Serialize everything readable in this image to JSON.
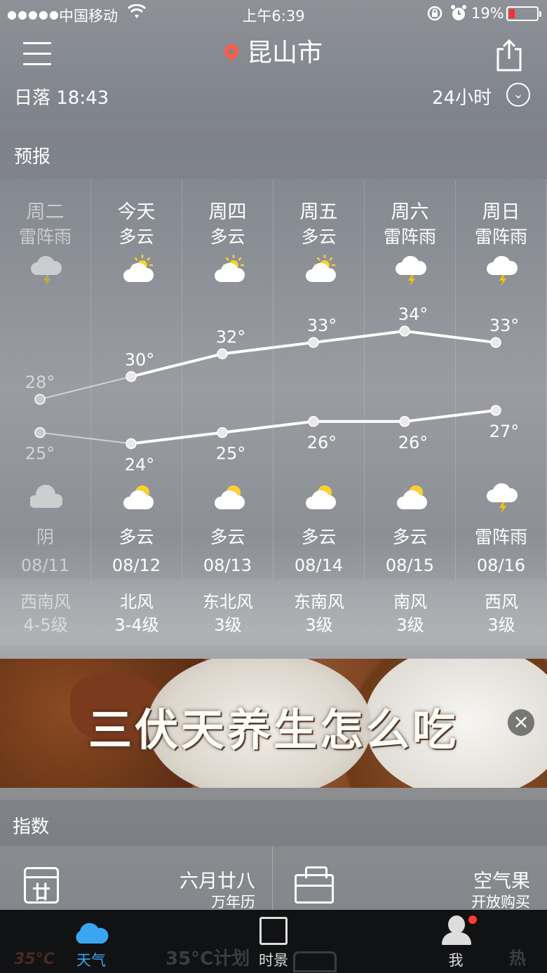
{
  "status_bar": {
    "signal": "●●●●●",
    "carrier": "中国移动",
    "time": "上午6:39",
    "battery_pct": "19%",
    "battery_level": 0.19
  },
  "header": {
    "city": "昆山市",
    "sunset": "日落 18:43",
    "hours_label": "24小时"
  },
  "forecast": {
    "title": "预报",
    "days": [
      {
        "day": "周二",
        "cond_day": "雷阵雨",
        "icon_day": "thunder-cloud-icon",
        "high": "28°",
        "low": "25°",
        "icon_night": "cloud-icon",
        "cond_night": "阴",
        "date": "08/11",
        "wind_dir": "西南风",
        "wind_lvl": "4-5级",
        "past": true
      },
      {
        "day": "今天",
        "cond_day": "多云",
        "icon_day": "partly-sunny-icon",
        "high": "30°",
        "low": "24°",
        "icon_night": "partly-moon-icon",
        "cond_night": "多云",
        "date": "08/12",
        "wind_dir": "北风",
        "wind_lvl": "3-4级",
        "past": false
      },
      {
        "day": "周四",
        "cond_day": "多云",
        "icon_day": "partly-sunny-icon",
        "high": "32°",
        "low": "25°",
        "icon_night": "partly-moon-icon",
        "cond_night": "多云",
        "date": "08/13",
        "wind_dir": "东北风",
        "wind_lvl": "3级",
        "past": false
      },
      {
        "day": "周五",
        "cond_day": "多云",
        "icon_day": "partly-sunny-icon",
        "high": "33°",
        "low": "26°",
        "icon_night": "partly-moon-icon",
        "cond_night": "多云",
        "date": "08/14",
        "wind_dir": "东南风",
        "wind_lvl": "3级",
        "past": false
      },
      {
        "day": "周六",
        "cond_day": "雷阵雨",
        "icon_day": "thunder-cloud-icon",
        "high": "34°",
        "low": "26°",
        "icon_night": "partly-moon-icon",
        "cond_night": "多云",
        "date": "08/15",
        "wind_dir": "南风",
        "wind_lvl": "3级",
        "past": false
      },
      {
        "day": "周日",
        "cond_day": "雷阵雨",
        "icon_day": "thunder-cloud-icon",
        "high": "33°",
        "low": "27°",
        "icon_night": "thunder-cloud-icon",
        "cond_night": "雷阵雨",
        "date": "08/16",
        "wind_dir": "西风",
        "wind_lvl": "3级",
        "past": false
      }
    ],
    "high_values": [
      28,
      30,
      32,
      33,
      34,
      33
    ],
    "low_values": [
      25,
      24,
      25,
      26,
      26,
      27
    ]
  },
  "banner": {
    "text": "三伏天养生怎么吃",
    "close": "×"
  },
  "index": {
    "title": "指数",
    "calendar_icon_text": "廿",
    "lunar_date": "六月廿八",
    "lunar_sub": "万年历",
    "air_title": "空气果",
    "air_sub": "开放购买"
  },
  "tabbar": {
    "weather": "天气",
    "scene": "时景",
    "me": "我",
    "promo": "35°C计划",
    "promo_logo": "35°C",
    "hot": "热"
  },
  "colors": {
    "accent_blue": "#3aa6f2",
    "battery_red": "#ff2d2d",
    "pin_red": "#ff5a48",
    "badge_red": "#ff3b30"
  }
}
